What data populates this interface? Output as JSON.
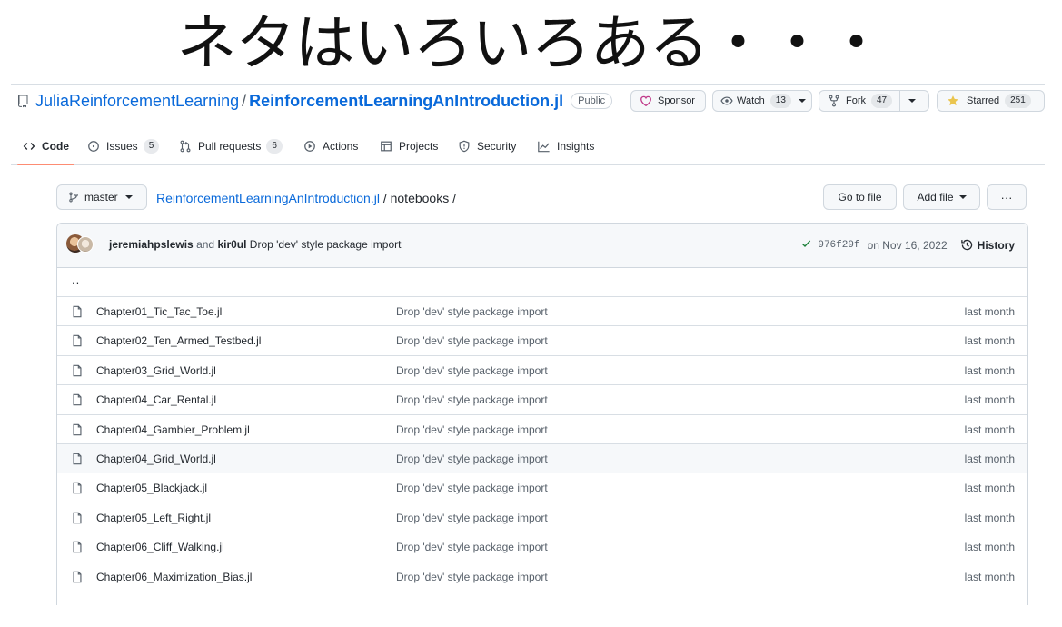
{
  "slide_title": "ネタはいろいろある・・・",
  "repo": {
    "owner": "JuliaReinforcementLearning",
    "separator": "/",
    "name": "ReinforcementLearningAnIntroduction.jl",
    "visibility": "Public"
  },
  "header_actions": {
    "sponsor": "Sponsor",
    "watch": "Watch",
    "watch_count": "13",
    "fork": "Fork",
    "fork_count": "47",
    "starred": "Starred",
    "star_count": "251"
  },
  "tabs": [
    {
      "label": "Code",
      "count": null,
      "icon": "code-icon",
      "active": true
    },
    {
      "label": "Issues",
      "count": "5",
      "icon": "issue-icon"
    },
    {
      "label": "Pull requests",
      "count": "6",
      "icon": "pull-request-icon"
    },
    {
      "label": "Actions",
      "count": null,
      "icon": "play-icon"
    },
    {
      "label": "Projects",
      "count": null,
      "icon": "table-icon"
    },
    {
      "label": "Security",
      "count": null,
      "icon": "shield-icon"
    },
    {
      "label": "Insights",
      "count": null,
      "icon": "graph-icon"
    }
  ],
  "path_bar": {
    "branch": "master",
    "repo_link": "ReinforcementLearningAnIntroduction.jl",
    "sep1": "/",
    "folder": "notebooks",
    "sep2": "/",
    "go_to_file": "Go to file",
    "add_file": "Add file",
    "more": "···"
  },
  "latest_commit": {
    "author1": "jeremiahpslewis",
    "and": "and",
    "author2": "kir0ul",
    "message": "Drop 'dev' style package import",
    "sha": "976f29f",
    "date": "on Nov 16, 2022",
    "history": "History"
  },
  "parent_dir": "..",
  "files": [
    {
      "name": "Chapter01_Tic_Tac_Toe.jl",
      "message": "Drop 'dev' style package import",
      "age": "last month"
    },
    {
      "name": "Chapter02_Ten_Armed_Testbed.jl",
      "message": "Drop 'dev' style package import",
      "age": "last month"
    },
    {
      "name": "Chapter03_Grid_World.jl",
      "message": "Drop 'dev' style package import",
      "age": "last month"
    },
    {
      "name": "Chapter04_Car_Rental.jl",
      "message": "Drop 'dev' style package import",
      "age": "last month"
    },
    {
      "name": "Chapter04_Gambler_Problem.jl",
      "message": "Drop 'dev' style package import",
      "age": "last month"
    },
    {
      "name": "Chapter04_Grid_World.jl",
      "message": "Drop 'dev' style package import",
      "age": "last month",
      "highlighted": true
    },
    {
      "name": "Chapter05_Blackjack.jl",
      "message": "Drop 'dev' style package import",
      "age": "last month"
    },
    {
      "name": "Chapter05_Left_Right.jl",
      "message": "Drop 'dev' style package import",
      "age": "last month"
    },
    {
      "name": "Chapter06_Cliff_Walking.jl",
      "message": "Drop 'dev' style package import",
      "age": "last month"
    },
    {
      "name": "Chapter06_Maximization_Bias.jl",
      "message": "Drop 'dev' style package import",
      "age": "last month"
    }
  ],
  "colors": {
    "link": "#0969da",
    "tab_underline": "#fd8c73",
    "sponsor_heart": "#bf3989",
    "star": "#eac54f",
    "check": "#1a7f37"
  }
}
